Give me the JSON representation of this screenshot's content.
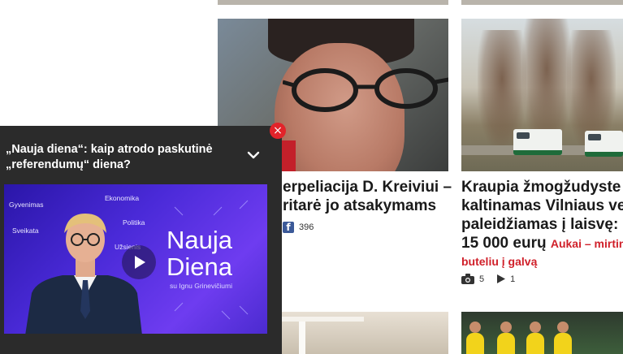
{
  "articles": [
    {
      "title": "... erpeliacija D. Kreiviui – ... ritarė jo atsakymams",
      "title_line1": "erpeliacija D. Kreiviui –",
      "title_line2": "ritarė jo atsakymams",
      "facebook_count": "396",
      "icon": "facebook-icon"
    },
    {
      "title_line1": "Kraupia žmogžudyste",
      "title_line2": "kaltinamas Vilniaus ver",
      "title_line3": "paleidžiamas į laisvę: u",
      "title_line4": "15 000 eurų",
      "tag_line1": "Aukai – mirtina",
      "tag_line2": "buteliu į galvą",
      "photo_count": "5",
      "video_count": "1",
      "icons": [
        "camera-icon",
        "play-icon"
      ]
    }
  ],
  "video_widget": {
    "title_line1": "„Nauja diena“: kaip atrodo paskutinė",
    "title_line2": "„referendumų“ diena?",
    "close_symbol": "×",
    "categories": [
      "Gyvenimas",
      "Ekonomika",
      "Politika",
      "Sveikata",
      "Užsienis"
    ],
    "brand_line1": "Nauja",
    "brand_line2": "Diena",
    "host": "su Ignu Grinevičiumi",
    "colors": {
      "background": "#2b2b2b",
      "close": "#e2232a",
      "video_bg": "#4a2ad8"
    }
  }
}
